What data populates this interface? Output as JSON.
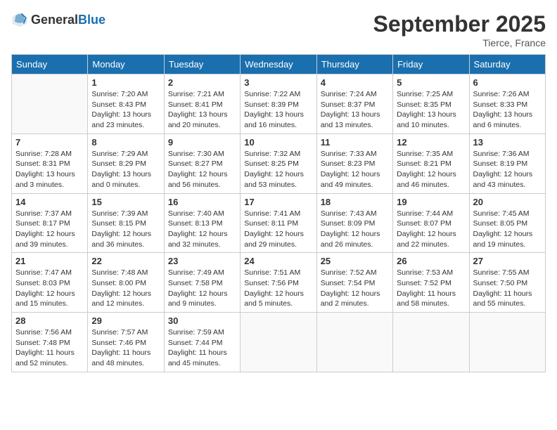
{
  "logo": {
    "general": "General",
    "blue": "Blue"
  },
  "header": {
    "month": "September 2025",
    "location": "Tierce, France"
  },
  "weekdays": [
    "Sunday",
    "Monday",
    "Tuesday",
    "Wednesday",
    "Thursday",
    "Friday",
    "Saturday"
  ],
  "weeks": [
    [
      {
        "day": "",
        "info": ""
      },
      {
        "day": "1",
        "info": "Sunrise: 7:20 AM\nSunset: 8:43 PM\nDaylight: 13 hours\nand 23 minutes."
      },
      {
        "day": "2",
        "info": "Sunrise: 7:21 AM\nSunset: 8:41 PM\nDaylight: 13 hours\nand 20 minutes."
      },
      {
        "day": "3",
        "info": "Sunrise: 7:22 AM\nSunset: 8:39 PM\nDaylight: 13 hours\nand 16 minutes."
      },
      {
        "day": "4",
        "info": "Sunrise: 7:24 AM\nSunset: 8:37 PM\nDaylight: 13 hours\nand 13 minutes."
      },
      {
        "day": "5",
        "info": "Sunrise: 7:25 AM\nSunset: 8:35 PM\nDaylight: 13 hours\nand 10 minutes."
      },
      {
        "day": "6",
        "info": "Sunrise: 7:26 AM\nSunset: 8:33 PM\nDaylight: 13 hours\nand 6 minutes."
      }
    ],
    [
      {
        "day": "7",
        "info": "Sunrise: 7:28 AM\nSunset: 8:31 PM\nDaylight: 13 hours\nand 3 minutes."
      },
      {
        "day": "8",
        "info": "Sunrise: 7:29 AM\nSunset: 8:29 PM\nDaylight: 13 hours\nand 0 minutes."
      },
      {
        "day": "9",
        "info": "Sunrise: 7:30 AM\nSunset: 8:27 PM\nDaylight: 12 hours\nand 56 minutes."
      },
      {
        "day": "10",
        "info": "Sunrise: 7:32 AM\nSunset: 8:25 PM\nDaylight: 12 hours\nand 53 minutes."
      },
      {
        "day": "11",
        "info": "Sunrise: 7:33 AM\nSunset: 8:23 PM\nDaylight: 12 hours\nand 49 minutes."
      },
      {
        "day": "12",
        "info": "Sunrise: 7:35 AM\nSunset: 8:21 PM\nDaylight: 12 hours\nand 46 minutes."
      },
      {
        "day": "13",
        "info": "Sunrise: 7:36 AM\nSunset: 8:19 PM\nDaylight: 12 hours\nand 43 minutes."
      }
    ],
    [
      {
        "day": "14",
        "info": "Sunrise: 7:37 AM\nSunset: 8:17 PM\nDaylight: 12 hours\nand 39 minutes."
      },
      {
        "day": "15",
        "info": "Sunrise: 7:39 AM\nSunset: 8:15 PM\nDaylight: 12 hours\nand 36 minutes."
      },
      {
        "day": "16",
        "info": "Sunrise: 7:40 AM\nSunset: 8:13 PM\nDaylight: 12 hours\nand 32 minutes."
      },
      {
        "day": "17",
        "info": "Sunrise: 7:41 AM\nSunset: 8:11 PM\nDaylight: 12 hours\nand 29 minutes."
      },
      {
        "day": "18",
        "info": "Sunrise: 7:43 AM\nSunset: 8:09 PM\nDaylight: 12 hours\nand 26 minutes."
      },
      {
        "day": "19",
        "info": "Sunrise: 7:44 AM\nSunset: 8:07 PM\nDaylight: 12 hours\nand 22 minutes."
      },
      {
        "day": "20",
        "info": "Sunrise: 7:45 AM\nSunset: 8:05 PM\nDaylight: 12 hours\nand 19 minutes."
      }
    ],
    [
      {
        "day": "21",
        "info": "Sunrise: 7:47 AM\nSunset: 8:03 PM\nDaylight: 12 hours\nand 15 minutes."
      },
      {
        "day": "22",
        "info": "Sunrise: 7:48 AM\nSunset: 8:00 PM\nDaylight: 12 hours\nand 12 minutes."
      },
      {
        "day": "23",
        "info": "Sunrise: 7:49 AM\nSunset: 7:58 PM\nDaylight: 12 hours\nand 9 minutes."
      },
      {
        "day": "24",
        "info": "Sunrise: 7:51 AM\nSunset: 7:56 PM\nDaylight: 12 hours\nand 5 minutes."
      },
      {
        "day": "25",
        "info": "Sunrise: 7:52 AM\nSunset: 7:54 PM\nDaylight: 12 hours\nand 2 minutes."
      },
      {
        "day": "26",
        "info": "Sunrise: 7:53 AM\nSunset: 7:52 PM\nDaylight: 11 hours\nand 58 minutes."
      },
      {
        "day": "27",
        "info": "Sunrise: 7:55 AM\nSunset: 7:50 PM\nDaylight: 11 hours\nand 55 minutes."
      }
    ],
    [
      {
        "day": "28",
        "info": "Sunrise: 7:56 AM\nSunset: 7:48 PM\nDaylight: 11 hours\nand 52 minutes."
      },
      {
        "day": "29",
        "info": "Sunrise: 7:57 AM\nSunset: 7:46 PM\nDaylight: 11 hours\nand 48 minutes."
      },
      {
        "day": "30",
        "info": "Sunrise: 7:59 AM\nSunset: 7:44 PM\nDaylight: 11 hours\nand 45 minutes."
      },
      {
        "day": "",
        "info": ""
      },
      {
        "day": "",
        "info": ""
      },
      {
        "day": "",
        "info": ""
      },
      {
        "day": "",
        "info": ""
      }
    ]
  ]
}
